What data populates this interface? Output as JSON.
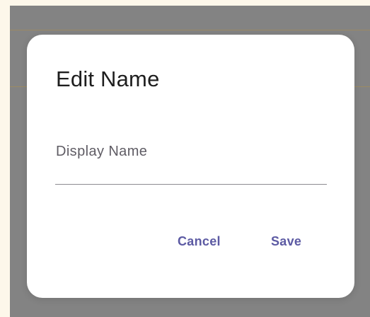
{
  "dialog": {
    "title": "Edit Name",
    "field": {
      "label": "Display Name",
      "value": ""
    },
    "actions": {
      "cancel_label": "Cancel",
      "save_label": "Save"
    }
  },
  "colors": {
    "page_background": "#fdf7ea",
    "scrim": "#838383",
    "surface": "#ffffff",
    "primary": "#5c5aa3",
    "underline": "#8c8a91"
  }
}
